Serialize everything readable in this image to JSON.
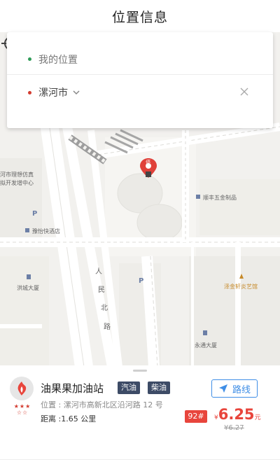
{
  "header": {
    "title": "位置信息"
  },
  "search": {
    "my_location": "我的位置",
    "destination": "漯河市"
  },
  "map": {
    "labels": {
      "l1": "河市理想仿真",
      "l2": "拟开发增中心",
      "l3": "顺丰五金制品",
      "l4": "豫怡快酒店",
      "l5": "人",
      "l6": "民",
      "l7": "北",
      "l8": "路",
      "l9": "洪城大厦",
      "l10": "泽金轩炎艺馆",
      "l11": "永通大厦",
      "p1": "P",
      "p2": "P",
      "pin_text": "停"
    }
  },
  "station": {
    "name": "油果果加油站",
    "tags": [
      "汽油",
      "柴油"
    ],
    "route_label": "路线",
    "address": "位置 : 漯河市高新北区沿河路 12 号",
    "distance": "距离 :1.65 公里",
    "fuel_type": "92#",
    "currency": "¥",
    "price": "6.25",
    "unit": "元",
    "old_price": "¥6.27",
    "stars_filled": "★★★",
    "stars_empty": "☆☆"
  },
  "colors": {
    "accent": "#3f8ee6",
    "price": "#e8453c",
    "tag": "#3d4b66"
  }
}
